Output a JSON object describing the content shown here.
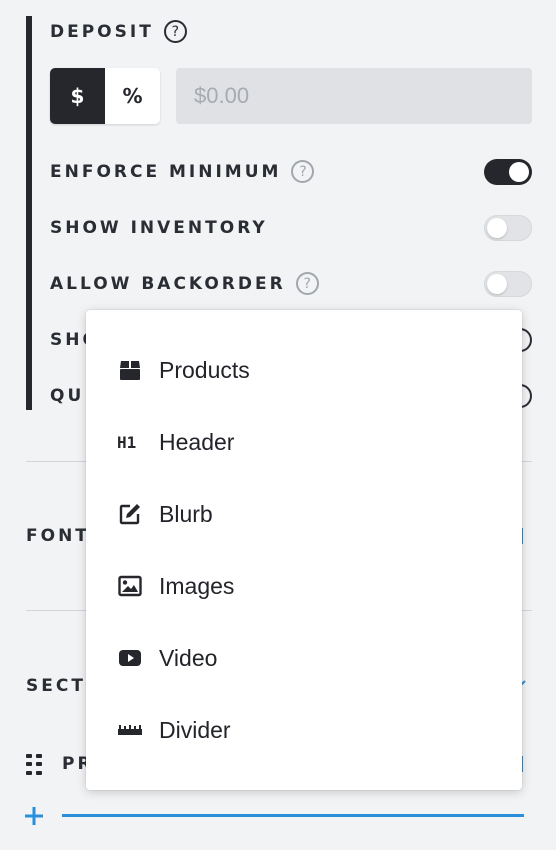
{
  "deposit": {
    "label": "DEPOSIT",
    "help": "?",
    "type_options": [
      "$",
      "%"
    ],
    "selected_type": "$",
    "amount_placeholder": "$0.00"
  },
  "toggles": [
    {
      "label": "ENFORCE MINIMUM",
      "help": "?",
      "on": true
    },
    {
      "label": "SHOW INVENTORY",
      "on": false
    },
    {
      "label": "ALLOW BACKORDER",
      "help": "?",
      "on": false
    },
    {
      "label": "SHO",
      "on": false
    },
    {
      "label": "QU",
      "on": false
    }
  ],
  "sections_behind": {
    "font_label": "FONT",
    "section_label": "SECT",
    "section_item_label": "PR"
  },
  "menu": {
    "items": [
      {
        "label": "Products",
        "icon": "box-icon"
      },
      {
        "label": "Header",
        "icon": "heading-h1-icon"
      },
      {
        "label": "Blurb",
        "icon": "edit-icon"
      },
      {
        "label": "Images",
        "icon": "image-icon"
      },
      {
        "label": "Video",
        "icon": "youtube-play-icon"
      },
      {
        "label": "Divider",
        "icon": "ruler-icon"
      }
    ]
  },
  "colors": {
    "background": "#f2f3f5",
    "dark": "#25272d",
    "accent": "#2a8fdb"
  }
}
